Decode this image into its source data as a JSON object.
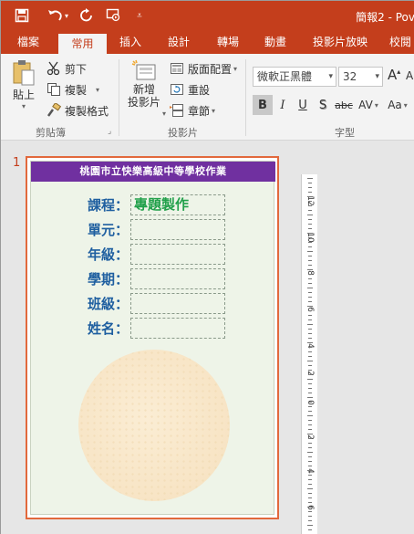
{
  "window": {
    "title": "簡報2 - Pov"
  },
  "qat": {
    "items": [
      {
        "name": "save-icon"
      },
      {
        "name": "undo-icon"
      },
      {
        "name": "redo-icon"
      },
      {
        "name": "present-icon"
      },
      {
        "name": "customize-qat-icon"
      }
    ]
  },
  "tabs": [
    "檔案",
    "常用",
    "插入",
    "設計",
    "轉場",
    "動畫",
    "投影片放映",
    "校閱"
  ],
  "ribbon": {
    "clipboard": {
      "paste_label": "貼上",
      "cut_label": "剪下",
      "copy_label": "複製",
      "format_painter_label": "複製格式",
      "group_label": "剪貼簿"
    },
    "slides": {
      "new_slide_label": "新增\n投影片",
      "new_slide_line1": "新增",
      "new_slide_line2": "投影片",
      "layout_label": "版面配置",
      "reset_label": "重設",
      "section_label": "章節",
      "group_label": "投影片"
    },
    "font": {
      "font_name": "微軟正黑體",
      "font_size": "32",
      "grow_label": "A",
      "shrink_label": "A",
      "bold": "B",
      "italic": "I",
      "underline": "U",
      "shadow": "S",
      "strike": "abc",
      "spacing": "AV",
      "case": "Aa",
      "group_label": "字型"
    }
  },
  "slide_pane": {
    "slide_number": "1",
    "header_text": "桃園市立快樂高級中等學校作業",
    "fields": [
      {
        "label": "課程：",
        "value": "專題製作"
      },
      {
        "label": "單元：",
        "value": ""
      },
      {
        "label": "年級：",
        "value": ""
      },
      {
        "label": "學期：",
        "value": ""
      },
      {
        "label": "班級：",
        "value": ""
      },
      {
        "label": "姓名：",
        "value": ""
      }
    ]
  },
  "ruler": {
    "labels": [
      "12",
      "10",
      "8",
      "6",
      "4",
      "2",
      "0",
      "2",
      "4",
      "6"
    ]
  },
  "colors": {
    "accent": "#c43e1c",
    "header_purple": "#7030a0",
    "label_blue": "#1f5fa0",
    "value_green": "#21a04a",
    "selection_orange": "#e2683c"
  }
}
